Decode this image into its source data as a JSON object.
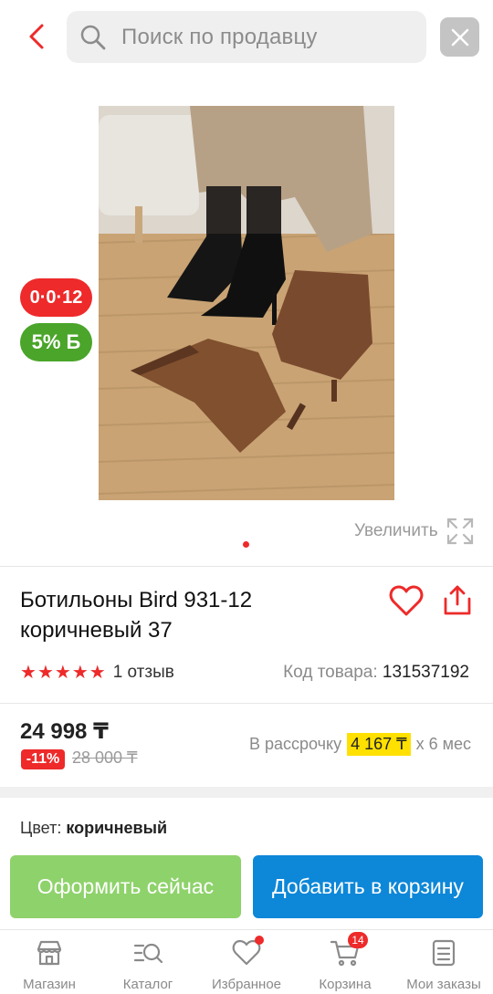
{
  "header": {
    "search_placeholder": "Поиск по продавцу",
    "back_icon": "chevron-left-icon",
    "close_icon": "close-icon",
    "accent": "#ee2a2a"
  },
  "gallery": {
    "badge_installment": "0·0·12",
    "badge_bonus": "5% Б",
    "zoom_label": "Увеличить",
    "image_count": 1,
    "current_index": 1
  },
  "product": {
    "title": "Ботильоны Bird 931-12 коричневый 37",
    "rating_stars": 5,
    "reviews": "1 отзыв",
    "sku_label": "Код товара:",
    "sku_value": "131537192"
  },
  "pricing": {
    "price": "24 998 ₸",
    "discount": "-11%",
    "old_price": "28 000 ₸",
    "installment_prefix": "В рассрочку",
    "installment_amount": "4 167 ₸",
    "installment_suffix": "х 6 мес"
  },
  "attributes": {
    "color_label": "Цвет:",
    "color_value": "коричневый"
  },
  "actions": {
    "buy_now": "Оформить сейчас",
    "add_to_cart": "Добавить в корзину",
    "buy_color": "#8ed26b",
    "cart_color": "#0d87d8"
  },
  "nav": {
    "items": [
      {
        "label": "Магазин",
        "icon": "store-icon"
      },
      {
        "label": "Каталог",
        "icon": "catalog-search-icon"
      },
      {
        "label": "Избранное",
        "icon": "heart-icon"
      },
      {
        "label": "Корзина",
        "icon": "cart-icon",
        "badge": "14"
      },
      {
        "label": "Мои заказы",
        "icon": "orders-icon"
      }
    ]
  }
}
